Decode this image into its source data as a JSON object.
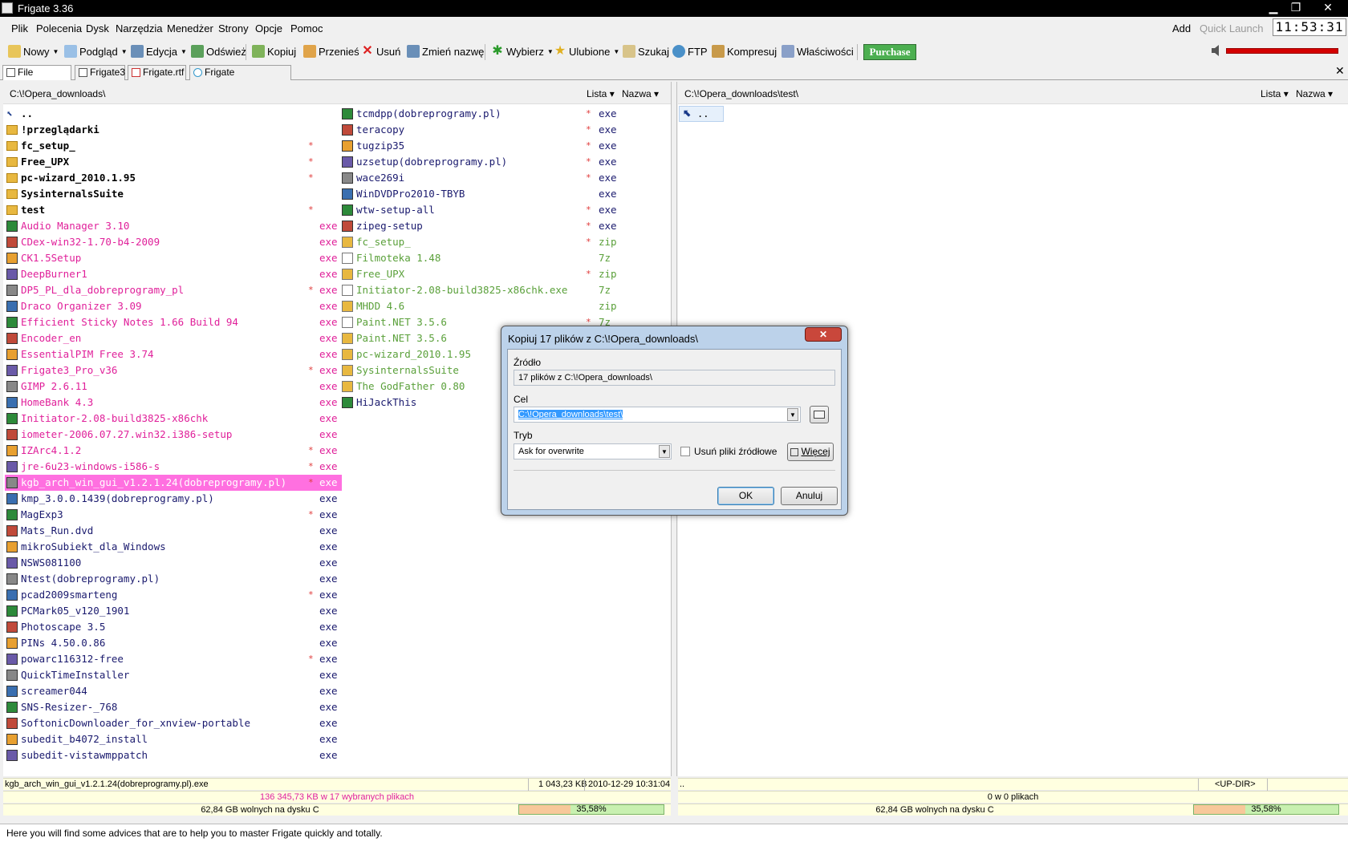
{
  "window": {
    "title": "Frigate 3.36",
    "min": "▁",
    "max": "❐",
    "close": "✕"
  },
  "menu": [
    "Plik",
    "Polecenia",
    "Dysk",
    "Narzędzia",
    "Menedżer",
    "Strony",
    "Opcje",
    "Pomoc"
  ],
  "menu_right": {
    "add": "Add",
    "quick_launch": "Quick Launch",
    "clock": "11:53:31"
  },
  "toolbar": {
    "nowy": "Nowy",
    "podglad": "Podgląd",
    "edycja": "Edycja",
    "odswiez": "Odśwież",
    "kopiuj": "Kopiuj",
    "przenies": "Przenieś",
    "usun": "Usuń",
    "zmien": "Zmień nazwę",
    "wybierz": "Wybierz",
    "ulubione": "Ulubione",
    "szukaj": "Szukaj",
    "ftp": "FTP",
    "kompresuj": "Kompresuj",
    "wlasciwosci": "Właściwości",
    "purchase": "Purchase"
  },
  "tabs": [
    "File Manager",
    "Frigate3",
    "Frigate.rtf",
    "Frigate Features.htm"
  ],
  "left_panel": {
    "path": "C:\\!Opera_downloads\\",
    "view": "Lista",
    "sort": "Nazwa",
    "col1": [
      {
        "n": "..",
        "e": "",
        "s": false,
        "c": "up"
      },
      {
        "n": "!przeglądarki",
        "e": "",
        "s": false,
        "c": "dir"
      },
      {
        "n": "fc_setup_",
        "e": "",
        "s": true,
        "c": "dir"
      },
      {
        "n": "Free_UPX",
        "e": "",
        "s": true,
        "c": "dir"
      },
      {
        "n": "pc-wizard_2010.1.95",
        "e": "",
        "s": true,
        "c": "dir"
      },
      {
        "n": "SysinternalsSuite",
        "e": "",
        "s": false,
        "c": "dir"
      },
      {
        "n": "test",
        "e": "",
        "s": true,
        "c": "dir"
      },
      {
        "n": "Audio Manager 3.10",
        "e": "exe",
        "s": false,
        "c": "pink"
      },
      {
        "n": "CDex-win32-1.70-b4-2009",
        "e": "exe",
        "s": false,
        "c": "pink"
      },
      {
        "n": "CK1.5Setup",
        "e": "exe",
        "s": false,
        "c": "pink"
      },
      {
        "n": "DeepBurner1",
        "e": "exe",
        "s": false,
        "c": "pink"
      },
      {
        "n": "DP5_PL_dla_dobreprogramy_pl",
        "e": "exe",
        "s": true,
        "c": "pink"
      },
      {
        "n": "Draco Organizer 3.09",
        "e": "exe",
        "s": false,
        "c": "pink"
      },
      {
        "n": "Efficient Sticky Notes 1.66 Build 94",
        "e": "exe",
        "s": false,
        "c": "pink"
      },
      {
        "n": "Encoder_en",
        "e": "exe",
        "s": false,
        "c": "pink"
      },
      {
        "n": "EssentialPIM Free 3.74",
        "e": "exe",
        "s": false,
        "c": "pink"
      },
      {
        "n": "Frigate3_Pro_v36",
        "e": "exe",
        "s": true,
        "c": "pink"
      },
      {
        "n": "GIMP 2.6.11",
        "e": "exe",
        "s": false,
        "c": "pink"
      },
      {
        "n": "HomeBank 4.3",
        "e": "exe",
        "s": false,
        "c": "pink"
      },
      {
        "n": "Initiator-2.08-build3825-x86chk",
        "e": "exe",
        "s": false,
        "c": "pink"
      },
      {
        "n": "iometer-2006.07.27.win32.i386-setup",
        "e": "exe",
        "s": false,
        "c": "pink"
      },
      {
        "n": "IZArc4.1.2",
        "e": "exe",
        "s": true,
        "c": "pink"
      },
      {
        "n": "jre-6u23-windows-i586-s",
        "e": "exe",
        "s": true,
        "c": "pink"
      },
      {
        "n": "kgb_arch_win_gui_v1.2.1.24(dobreprogramy.pl)",
        "e": "exe",
        "s": true,
        "c": "sel"
      },
      {
        "n": "kmp_3.0.0.1439(dobreprogramy.pl)",
        "e": "exe",
        "s": false,
        "c": "navy"
      },
      {
        "n": "MagExp3",
        "e": "exe",
        "s": true,
        "c": "navy"
      },
      {
        "n": "Mats_Run.dvd",
        "e": "exe",
        "s": false,
        "c": "navy"
      },
      {
        "n": "mikroSubiekt_dla_Windows",
        "e": "exe",
        "s": false,
        "c": "navy"
      },
      {
        "n": "NSWS081100",
        "e": "exe",
        "s": false,
        "c": "navy"
      },
      {
        "n": "Ntest(dobreprogramy.pl)",
        "e": "exe",
        "s": false,
        "c": "navy"
      },
      {
        "n": "pcad2009smarteng",
        "e": "exe",
        "s": true,
        "c": "navy"
      },
      {
        "n": "PCMark05_v120_1901",
        "e": "exe",
        "s": false,
        "c": "navy"
      },
      {
        "n": "Photoscape 3.5",
        "e": "exe",
        "s": false,
        "c": "navy"
      },
      {
        "n": "PINs 4.50.0.86",
        "e": "exe",
        "s": false,
        "c": "navy"
      },
      {
        "n": "powarc116312-free",
        "e": "exe",
        "s": true,
        "c": "navy"
      },
      {
        "n": "QuickTimeInstaller",
        "e": "exe",
        "s": false,
        "c": "navy"
      },
      {
        "n": "screamer044",
        "e": "exe",
        "s": false,
        "c": "navy"
      },
      {
        "n": "SNS-Resizer-_768",
        "e": "exe",
        "s": false,
        "c": "navy"
      },
      {
        "n": "SoftonicDownloader_for_xnview-portable",
        "e": "exe",
        "s": false,
        "c": "navy"
      },
      {
        "n": "subedit_b4072_install",
        "e": "exe",
        "s": false,
        "c": "navy"
      },
      {
        "n": "subedit-vistawmppatch",
        "e": "exe",
        "s": false,
        "c": "navy"
      }
    ],
    "col2": [
      {
        "n": "tcmdpp(dobreprogramy.pl)",
        "e": "exe",
        "s": true,
        "c": "navy"
      },
      {
        "n": "teracopy",
        "e": "exe",
        "s": true,
        "c": "navy"
      },
      {
        "n": "tugzip35",
        "e": "exe",
        "s": true,
        "c": "navy"
      },
      {
        "n": "uzsetup(dobreprogramy.pl)",
        "e": "exe",
        "s": true,
        "c": "navy"
      },
      {
        "n": "wace269i",
        "e": "exe",
        "s": true,
        "c": "navy"
      },
      {
        "n": "WinDVDPro2010-TBYB",
        "e": "exe",
        "s": false,
        "c": "navy"
      },
      {
        "n": "wtw-setup-all",
        "e": "exe",
        "s": true,
        "c": "navy"
      },
      {
        "n": "zipeg-setup",
        "e": "exe",
        "s": true,
        "c": "navy"
      },
      {
        "n": "fc_setup_",
        "e": "zip",
        "s": true,
        "c": "green"
      },
      {
        "n": "Filmoteka 1.48",
        "e": "7z",
        "s": false,
        "c": "green"
      },
      {
        "n": "Free_UPX",
        "e": "zip",
        "s": true,
        "c": "green"
      },
      {
        "n": "Initiator-2.08-build3825-x86chk.exe",
        "e": "7z",
        "s": false,
        "c": "green"
      },
      {
        "n": "MHDD 4.6",
        "e": "zip",
        "s": false,
        "c": "green"
      },
      {
        "n": "Paint.NET 3.5.6",
        "e": "7z",
        "s": true,
        "c": "green"
      },
      {
        "n": "Paint.NET 3.5.6",
        "e": "zip",
        "s": false,
        "c": "green"
      },
      {
        "n": "pc-wizard_2010.1.95",
        "e": "zip",
        "s": false,
        "c": "green"
      },
      {
        "n": "SysinternalsSuite",
        "e": "zip",
        "s": false,
        "c": "green"
      },
      {
        "n": "The GodFather 0.80",
        "e": "zip",
        "s": false,
        "c": "green"
      },
      {
        "n": "HiJackThis",
        "e": "",
        "s": false,
        "c": "navy"
      }
    ],
    "status_file": "kgb_arch_win_gui_v1.2.1.24(dobreprogramy.pl).exe",
    "status_size": "1 043,23 KB",
    "status_date": "2010-12-29 10:31:04",
    "status_selected": "136 345,73 KB w 17 wybranych plikach",
    "status_free": "62,84 GB wolnych na dysku C",
    "status_pct": "35,58%",
    "used_fraction": 0.3558
  },
  "right_panel": {
    "path": "C:\\!Opera_downloads\\test\\",
    "view": "Lista",
    "sort": "Nazwa",
    "up": "..",
    "status_file": "..",
    "status_updir": "<UP-DIR>",
    "status_selected": "0 w 0 plikach",
    "status_free": "62,84 GB wolnych na dysku C",
    "status_pct": "35,58%",
    "used_fraction": 0.3558
  },
  "hint": "Here you will find some advices that are to help you to master Frigate quickly and totally.",
  "dialog": {
    "title": "Kopiuj 17 plików z C:\\!Opera_downloads\\",
    "close": "✕",
    "source_label": "Źródło",
    "source_value": "17 plików z C:\\!Opera_downloads\\",
    "target_label": "Cel",
    "target_value": "C:\\!Opera_downloads\\test\\",
    "mode_label": "Tryb",
    "mode_value": "Ask for overwrite",
    "delete_label": "Usuń pliki źródłowe",
    "more": "Więcej",
    "ok": "OK",
    "cancel": "Anuluj"
  }
}
